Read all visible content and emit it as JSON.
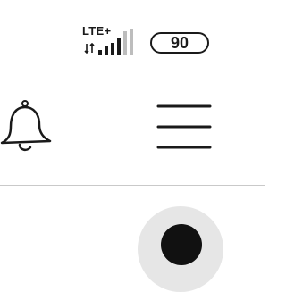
{
  "status_bar": {
    "network_type": "LTE+",
    "battery_level": "90",
    "signal_icon": "signal-strength-icon",
    "data_activity_icon": "data-activity-icon"
  },
  "header": {
    "notifications_icon": "bell-icon",
    "menu_icon": "hamburger-menu-icon"
  },
  "profile": {
    "avatar_icon": "avatar-icon"
  },
  "colors": {
    "foreground": "#1a1a1a",
    "divider": "#c9c9c9",
    "avatar_bg": "#e6e6e6",
    "inactive_bar": "#bdbdbd"
  }
}
